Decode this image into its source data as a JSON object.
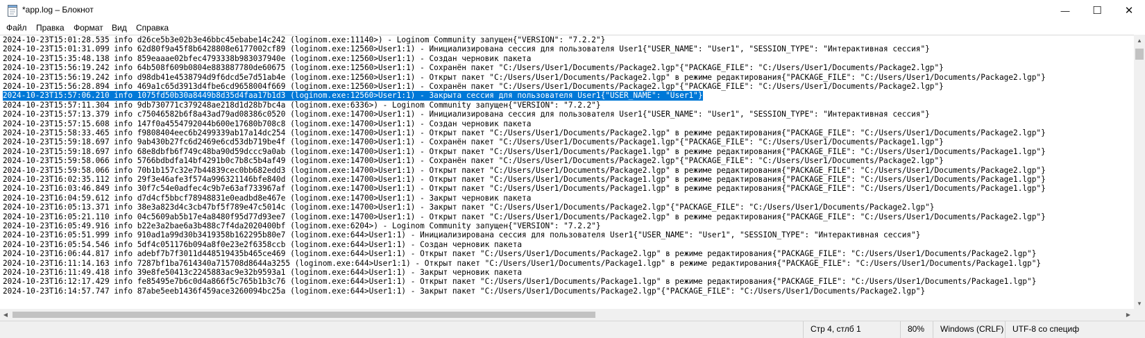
{
  "window": {
    "title": "*app.log – Блокнот",
    "minimize_glyph": "—",
    "maximize_glyph": "☐",
    "close_glyph": "✕"
  },
  "menu": [
    "Файл",
    "Правка",
    "Формат",
    "Вид",
    "Справка"
  ],
  "editor": {
    "selected_line": 6,
    "lines": [
      "2024-10-23T15:01:28.535 info d26ce5b3e02b3e46bbc45ebabe14c242 (loginom.exe:11140>) - Loginom Community запущен{\"VERSION\": \"7.2.2\"}",
      "2024-10-23T15:01:31.099 info 62d80f9a45f8b6428808e6177002cf89 (loginom.exe:12560>User1:1) - Инициализирована сессия для пользователя User1{\"USER_NAME\": \"User1\", \"SESSION_TYPE\": \"Интерактивная сессия\"}",
      "2024-10-23T15:35:48.138 info 859eaaae02bfec4793338b983037940e (loginom.exe:12560>User1:1) - Создан черновик пакета",
      "2024-10-23T15:56:19.242 info 64b508f609b0804e883887780de60675 (loginom.exe:12560>User1:1) - Сохранён пакет \"C:/Users/User1/Documents/Package2.lgp\"{\"PACKAGE_FILE\": \"C:/Users/User1/Documents/Package2.lgp\"}",
      "2024-10-23T15:56:19.242 info d98db41e4538794d9f6dcd5e7d51ab4e (loginom.exe:12560>User1:1) - Открыт пакет \"C:/Users/User1/Documents/Package2.lgp\" в режиме редактирования{\"PACKAGE_FILE\": \"C:/Users/User1/Documents/Package2.lgp\"}",
      "2024-10-23T15:56:28.894 info 469a1c65d3913d4fbe6cd9658004f669 (loginom.exe:12560>User1:1) - Сохранён пакет \"C:/Users/User1/Documents/Package2.lgp\"{\"PACKAGE_FILE\": \"C:/Users/User1/Documents/Package2.lgp\"}",
      "2024-10-23T15:57:06.210 info 1075fd50b30a8449b8d35d4faa17b1d3 (loginom.exe:12560>User1:1) - Закрыта сессия для пользователя User1{\"USER_NAME\": \"User1\"}",
      "2024-10-23T15:57:11.304 info 9db730771c379248ae218d1d28b7bc4a (loginom.exe:6336>) - Loginom Community запущен{\"VERSION\": \"7.2.2\"}",
      "2024-10-23T15:57:13.379 info c75046582b6f8a43ad79ad08386c0520 (loginom.exe:14700>User1:1) - Инициализирована сессия для пользователя User1{\"USER_NAME\": \"User1\", \"SESSION_TYPE\": \"Интерактивная сессия\"}",
      "2024-10-23T15:57:15.608 info 147f0a4554792044b600e17680b708c8 (loginom.exe:14700>User1:1) - Создан черновик пакета",
      "2024-10-23T15:58:33.465 info f9808404eec6b2499339ab17a14dc254 (loginom.exe:14700>User1:1) - Открыт пакет \"C:/Users/User1/Documents/Package2.lgp\" в режиме редактирования{\"PACKAGE_FILE\": \"C:/Users/User1/Documents/Package2.lgp\"}",
      "2024-10-23T15:59:18.697 info 9ab430b27fc6d2469e6cd53db719be4f (loginom.exe:14700>User1:1) - Сохранён пакет \"C:/Users/User1/Documents/Package1.lgp\"{\"PACKAGE_FILE\": \"C:/Users/User1/Documents/Package1.lgp\"}",
      "2024-10-23T15:59:18.697 info 68e8dbfb6f749c48ba90d59dccc9a0ab (loginom.exe:14700>User1:1) - Открыт пакет \"C:/Users/User1/Documents/Package1.lgp\" в режиме редактирования{\"PACKAGE_FILE\": \"C:/Users/User1/Documents/Package1.lgp\"}",
      "2024-10-23T15:59:58.066 info 5766bdbdfa14bf4291b0c7b8c5b4af49 (loginom.exe:14700>User1:1) - Сохранён пакет \"C:/Users/User1/Documents/Package2.lgp\"{\"PACKAGE_FILE\": \"C:/Users/User1/Documents/Package2.lgp\"}",
      "2024-10-23T15:59:58.066 info 70b1b157c32e7b44839cec0bb682edd3 (loginom.exe:14700>User1:1) - Открыт пакет \"C:/Users/User1/Documents/Package2.lgp\" в режиме редактирования{\"PACKAGE_FILE\": \"C:/Users/User1/Documents/Package2.lgp\"}",
      "2024-10-23T16:02:35.112 info 29f3e46afe3f574a996321146bfe840d (loginom.exe:14700>User1:1) - Открыт пакет \"C:/Users/User1/Documents/Package1.lgp\" в режиме редактирования{\"PACKAGE_FILE\": \"C:/Users/User1/Documents/Package1.lgp\"}",
      "2024-10-23T16:03:46.849 info 30f7c54e0adfec4c9b7e63af733967af (loginom.exe:14700>User1:1) - Открыт пакет \"C:/Users/User1/Documents/Package1.lgp\" в режиме редактирования{\"PACKAGE_FILE\": \"C:/Users/User1/Documents/Package1.lgp\"}",
      "2024-10-23T16:04:59.612 info d7d4cf5bbcf78948831e0eadbd8e467e (loginom.exe:14700>User1:1) - Закрыт черновик пакета",
      "2024-10-23T16:05:13.371 info 38e3a823d4c3cb47bf5f789e47c5014c (loginom.exe:14700>User1:1) - Закрыт пакет \"C:/Users/User1/Documents/Package2.lgp\"{\"PACKAGE_FILE\": \"C:/Users/User1/Documents/Package2.lgp\"}",
      "2024-10-23T16:05:21.110 info 04c5609ab5b17e4a8480f95d77d93ee7 (loginom.exe:14700>User1:1) - Открыт пакет \"C:/Users/User1/Documents/Package2.lgp\" в режиме редактирования{\"PACKAGE_FILE\": \"C:/Users/User1/Documents/Package2.lgp\"}",
      "2024-10-23T16:05:49.916 info b22e3a2bae6a3b488c7f4da2020400bf (loginom.exe:6204>) - Loginom Community запущен{\"VERSION\": \"7.2.2\"}",
      "2024-10-23T16:05:51.999 info 910ad1a99d30b3419358b162295b80e7 (loginom.exe:644>User1:1) - Инициализирована сессия для пользователя User1{\"USER_NAME\": \"User1\", \"SESSION_TYPE\": \"Интерактивная сессия\"}",
      "2024-10-23T16:05:54.546 info 5df4c051176b094a8f0e23e2f6358ccb (loginom.exe:644>User1:1) - Создан черновик пакета",
      "2024-10-23T16:06:44.817 info adebf7b7f3011d448519435b465ce469 (loginom.exe:644>User1:1) - Открыт пакет \"C:/Users/User1/Documents/Package2.lgp\" в режиме редактирования{\"PACKAGE_FILE\": \"C:/Users/User1/Documents/Package2.lgp\"}",
      "2024-10-23T16:11:14.163 info 7287bf1ba7614340a715708d8644a3255 (loginom.exe:644>User1:1) - Открыт пакет \"C:/Users/User1/Documents/Package1.lgp\" в режиме редактирования{\"PACKAGE_FILE\": \"C:/Users/User1/Documents/Package1.lgp\"}",
      "2024-10-23T16:11:49.418 info 39e8fe50413c2245883ac9e32b9593a1 (loginom.exe:644>User1:1) - Закрыт черновик пакета",
      "2024-10-23T16:12:17.429 info fe85495e7b6c0d4a866f5c765b1b3c76 (loginom.exe:644>User1:1) - Открыт пакет \"C:/Users/User1/Documents/Package1.lgp\" в режиме редактирования{\"PACKAGE_FILE\": \"C:/Users/User1/Documents/Package1.lgp\"}",
      "2024-10-23T16:14:57.747 info 87abe5eeb1436f459ace3260094bc25a (loginom.exe:644>User1:1) - Закрыт пакет \"C:/Users/User1/Documents/Package2.lgp\"{\"PACKAGE_FILE\": \"C:/Users/User1/Documents/Package2.lgp\"}"
    ]
  },
  "statusbar": {
    "position": "Стр 4, стлб 1",
    "zoom": "80%",
    "line_endings": "Windows (CRLF)",
    "encoding": "UTF-8 со специф"
  },
  "icons": {
    "app": "notepad-icon",
    "scroll_up": "arrow-up-icon",
    "scroll_down": "arrow-down-icon",
    "scroll_left": "arrow-left-icon",
    "scroll_right": "arrow-right-icon"
  },
  "colors": {
    "selection": "#0078d7",
    "statusbar": "#f0f0f0"
  }
}
